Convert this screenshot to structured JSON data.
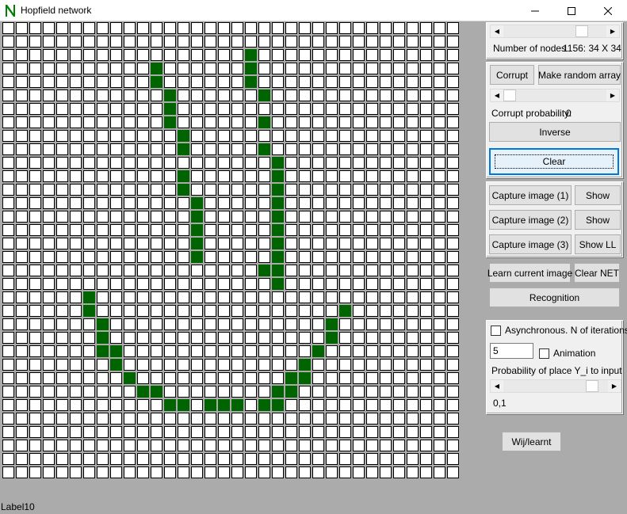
{
  "window": {
    "title": "Hopfield network",
    "icon": "app-n-icon"
  },
  "grid": {
    "rows": 34,
    "cols": 34,
    "active_color": "#006400",
    "active_cells": [
      [
        2,
        18
      ],
      [
        3,
        11
      ],
      [
        3,
        18
      ],
      [
        4,
        11
      ],
      [
        4,
        18
      ],
      [
        5,
        12
      ],
      [
        5,
        19
      ],
      [
        6,
        12
      ],
      [
        7,
        12
      ],
      [
        7,
        19
      ],
      [
        8,
        13
      ],
      [
        9,
        13
      ],
      [
        9,
        19
      ],
      [
        10,
        20
      ],
      [
        11,
        13
      ],
      [
        11,
        20
      ],
      [
        12,
        13
      ],
      [
        12,
        20
      ],
      [
        13,
        14
      ],
      [
        13,
        20
      ],
      [
        14,
        14
      ],
      [
        14,
        20
      ],
      [
        15,
        14
      ],
      [
        15,
        20
      ],
      [
        16,
        14
      ],
      [
        16,
        20
      ],
      [
        17,
        14
      ],
      [
        17,
        20
      ],
      [
        18,
        19
      ],
      [
        18,
        20
      ],
      [
        19,
        20
      ],
      [
        20,
        6
      ],
      [
        21,
        6
      ],
      [
        21,
        25
      ],
      [
        22,
        7
      ],
      [
        22,
        24
      ],
      [
        23,
        7
      ],
      [
        23,
        24
      ],
      [
        24,
        7
      ],
      [
        24,
        8
      ],
      [
        24,
        23
      ],
      [
        25,
        8
      ],
      [
        25,
        22
      ],
      [
        26,
        9
      ],
      [
        26,
        21
      ],
      [
        26,
        22
      ],
      [
        27,
        10
      ],
      [
        27,
        11
      ],
      [
        27,
        20
      ],
      [
        27,
        21
      ],
      [
        28,
        12
      ],
      [
        28,
        13
      ],
      [
        28,
        15
      ],
      [
        28,
        16
      ],
      [
        28,
        17
      ],
      [
        28,
        19
      ],
      [
        28,
        20
      ]
    ]
  },
  "panel_nodes": {
    "scroll_value": 0.8,
    "nodes_label": "Number of nodes",
    "nodes_value": "1156: 34 X 34"
  },
  "panel_corrupt": {
    "corrupt_label": "Corrupt",
    "random_label": "Make random array",
    "scroll_value": 0.0,
    "prob_label": "Corrupt probability:",
    "prob_value": "0",
    "inverse_label": "Inverse",
    "clear_label": "Clear"
  },
  "panel_capture": {
    "capture1": "Capture image (1)",
    "show1": "Show",
    "capture2": "Capture image (2)",
    "show2": "Show",
    "capture3": "Capture image (3)",
    "show_ll": "Show LL"
  },
  "learn": {
    "learn_label": "Learn current image",
    "clear_net_label": "Clear NET",
    "recognition_label": "Recognition"
  },
  "panel_async": {
    "async_label": "Asynchronous. N of iterations",
    "async_checked": false,
    "iterations_value": "5",
    "animation_label": "Animation",
    "animation_checked": false,
    "prob_place_label": "Probability of place Y_i to input",
    "scroll_value": 0.9,
    "prob_value": "0,1"
  },
  "wij_label": "Wij/learnt",
  "status_label": "Label10"
}
